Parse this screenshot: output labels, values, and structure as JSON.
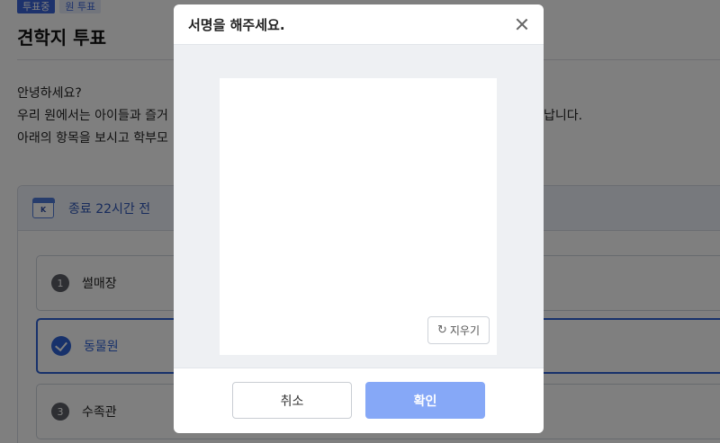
{
  "page": {
    "badges": {
      "status": "투표중",
      "type": "원 투표"
    },
    "title": "견학지 투표",
    "intro": {
      "line1": "안녕하세요?",
      "line2": "우리 원에서는 아이들과 즐거",
      "line2_tail": "납니다.",
      "line3": "아래의 항목을 보시고 학부모"
    }
  },
  "vote": {
    "deadline": "종료 22시간 전",
    "icon": "calendar-icon",
    "options": [
      {
        "number": "1",
        "label": "썰매장",
        "selected": false
      },
      {
        "number": "",
        "label": "동물원",
        "selected": true
      },
      {
        "number": "3",
        "label": "수족관",
        "selected": false
      }
    ]
  },
  "modal": {
    "title": "서명을 해주세요.",
    "clear_label": "지우기",
    "cancel_label": "취소",
    "confirm_label": "확인"
  },
  "colors": {
    "accent": "#2f62d6",
    "confirm_disabled": "#86a8f7",
    "overlay": "rgba(0,0,0,0.5)"
  }
}
